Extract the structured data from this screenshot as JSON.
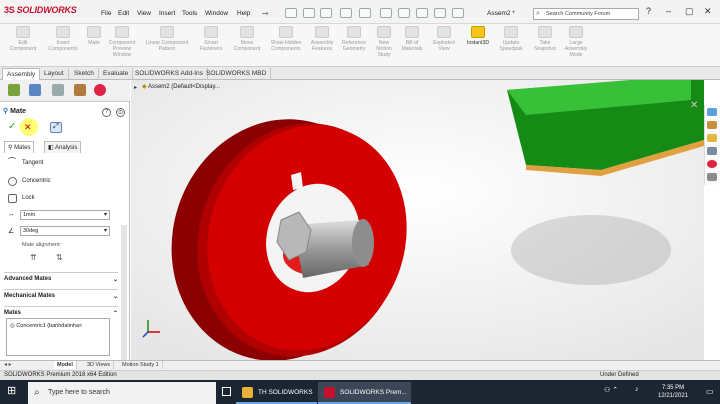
{
  "app": {
    "logo": "SOLIDWORKS",
    "doc_title": "Assem2 *"
  },
  "menu": [
    "File",
    "Edit",
    "View",
    "Insert",
    "Tools",
    "Window",
    "Help"
  ],
  "search": {
    "placeholder": "Search Community Forum"
  },
  "ribbon": [
    "Edit Component",
    "Insert Components",
    "Mate",
    "Component Preview Window",
    "Linear Component Pattern",
    "Smart Fasteners",
    "Move Component",
    "Show Hidden Components",
    "Assembly Features",
    "Reference Geometry",
    "New Motion Study",
    "Bill of Materials",
    "Exploded View",
    "Instant3D",
    "Update Speedpak",
    "Take Snapshot",
    "Large Assembly Mode"
  ],
  "tabs": [
    "Assembly",
    "Layout",
    "Sketch",
    "Evaluate",
    "SOLIDWORKS Add-Ins",
    "SOLIDWORKS MBD"
  ],
  "panel": {
    "title": "Mate",
    "subtabs": [
      "Mates",
      "Analysis"
    ],
    "mates": [
      "Tangent",
      "Concentric",
      "Lock"
    ],
    "distance": "1mm",
    "angle": "30deg",
    "alignment_label": "Mate alignment:",
    "sections": [
      "Advanced Mates",
      "Mechanical Mates",
      "Mates"
    ],
    "mates_list": [
      "Concentric1 (banhdaiinha<"
    ]
  },
  "tree_item": "Assem2  (Default<Display...",
  "bottom_tabs": [
    "Model",
    "3D Views",
    "Motion Study 1"
  ],
  "status": {
    "left": "SOLIDWORKS Premium 2018 x64 Edition",
    "right": "Under Defined"
  },
  "taskbar": {
    "search": "Type here to search",
    "apps": [
      "TH SOLIDWORKS",
      "SOLIDWORKS Prem..."
    ],
    "time": "7:35 PM",
    "date": "12/21/2021"
  },
  "colors": {
    "accent": "#c8102e",
    "part_red": "#d40000",
    "part_green": "#1f9a1f"
  }
}
